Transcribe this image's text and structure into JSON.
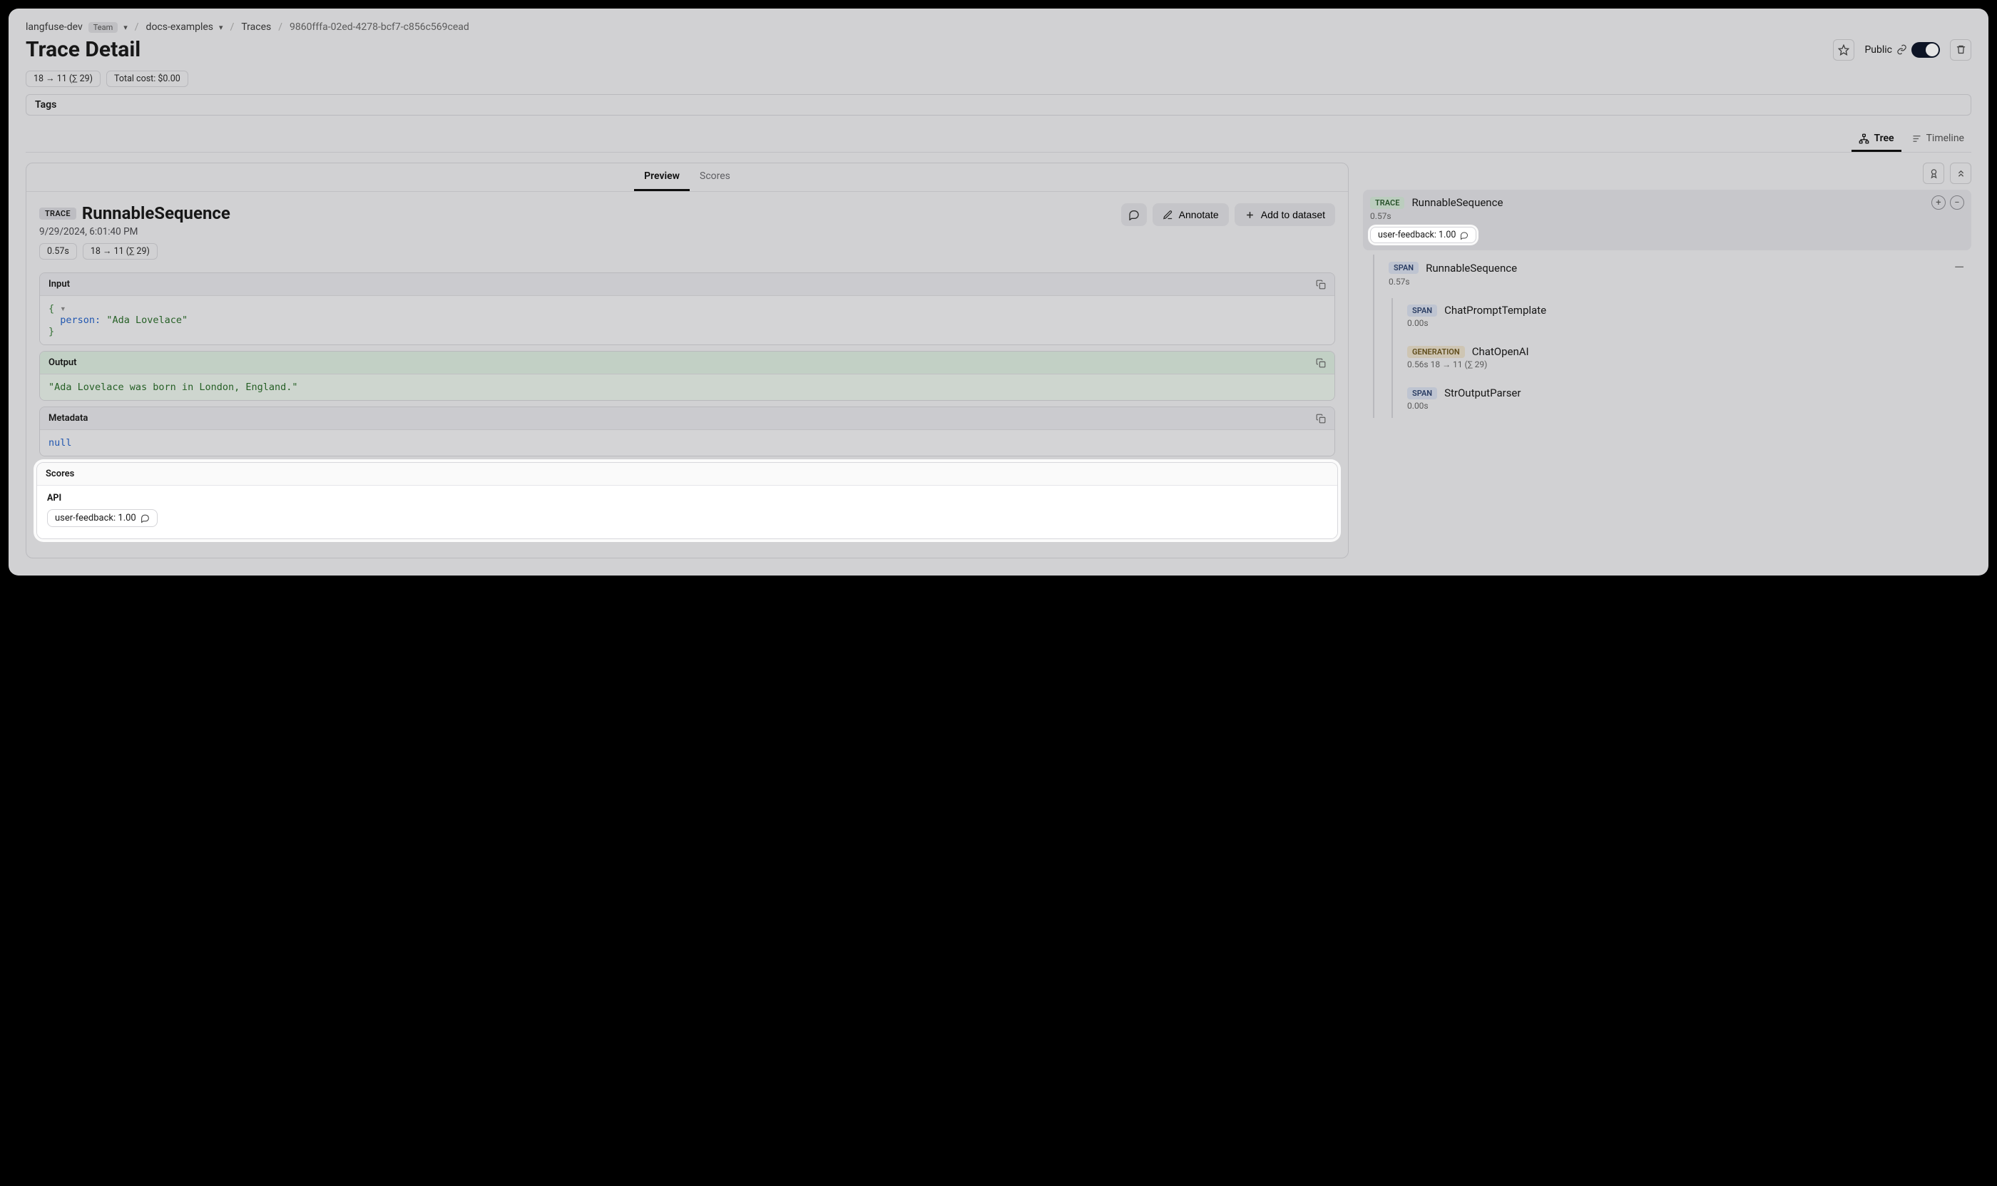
{
  "breadcrumb": {
    "org": "langfuse-dev",
    "team_badge": "Team",
    "project": "docs-examples",
    "section": "Traces",
    "trace_id": "9860fffa-02ed-4278-bcf7-c856c569cead"
  },
  "page_title": "Trace Detail",
  "header": {
    "public_label": "Public",
    "toggle_on": true
  },
  "stat_chips": {
    "tokens": "18 → 11 (∑ 29)",
    "cost": "Total cost: $0.00"
  },
  "tags_label": "Tags",
  "view_tabs": {
    "tree": "Tree",
    "timeline": "Timeline",
    "active": "tree"
  },
  "subtabs": {
    "preview": "Preview",
    "scores": "Scores",
    "active": "preview"
  },
  "detail": {
    "type_badge": "TRACE",
    "title": "RunnableSequence",
    "timestamp": "9/29/2024, 6:01:40 PM",
    "annotate_label": "Annotate",
    "add_dataset_label": "Add to dataset",
    "chips": {
      "latency": "0.57s",
      "tokens": "18 → 11 (∑ 29)"
    }
  },
  "input": {
    "label": "Input",
    "json_key": "person",
    "json_val": "\"Ada Lovelace\""
  },
  "output": {
    "label": "Output",
    "text": "\"Ada Lovelace was born in London, England.\""
  },
  "metadata": {
    "label": "Metadata",
    "value": "null"
  },
  "scores_panel": {
    "label": "Scores",
    "group": "API",
    "pill": "user-feedback: 1.00"
  },
  "tree": {
    "root": {
      "badge": "TRACE",
      "title": "RunnableSequence",
      "sub": "0.57s",
      "pill": "user-feedback: 1.00"
    },
    "child1": {
      "badge": "SPAN",
      "title": "RunnableSequence",
      "sub": "0.57s"
    },
    "g1": {
      "badge": "SPAN",
      "title": "ChatPromptTemplate",
      "sub": "0.00s"
    },
    "g2": {
      "badge": "GENERATION",
      "title": "ChatOpenAI",
      "sub": "0.56s   18 → 11 (∑ 29)"
    },
    "g3": {
      "badge": "SPAN",
      "title": "StrOutputParser",
      "sub": "0.00s"
    }
  }
}
